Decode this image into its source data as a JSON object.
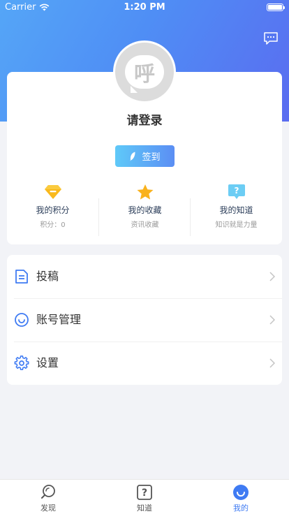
{
  "status_bar": {
    "carrier": "Carrier",
    "time": "1:20 PM"
  },
  "profile": {
    "avatar_text": "呼",
    "login_prompt": "请登录",
    "signin_label": "签到"
  },
  "stats": [
    {
      "title": "我的积分",
      "subtitle": "积分：0",
      "icon": "diamond-icon"
    },
    {
      "title": "我的收藏",
      "subtitle": "资讯收藏",
      "icon": "star-icon"
    },
    {
      "title": "我的知道",
      "subtitle": "知识就是力量",
      "icon": "question-bubble-icon"
    }
  ],
  "menu": [
    {
      "label": "投稿",
      "icon": "document-icon"
    },
    {
      "label": "账号管理",
      "icon": "smile-circle-icon"
    },
    {
      "label": "设置",
      "icon": "gear-icon"
    }
  ],
  "tabs": [
    {
      "label": "发现",
      "icon": "discover-icon"
    },
    {
      "label": "知道",
      "icon": "question-icon"
    },
    {
      "label": "我的",
      "icon": "me-icon",
      "active": true
    }
  ],
  "colors": {
    "accent": "#3f7bf3",
    "header_start": "#55a6f7",
    "header_end": "#5a6cf0"
  }
}
